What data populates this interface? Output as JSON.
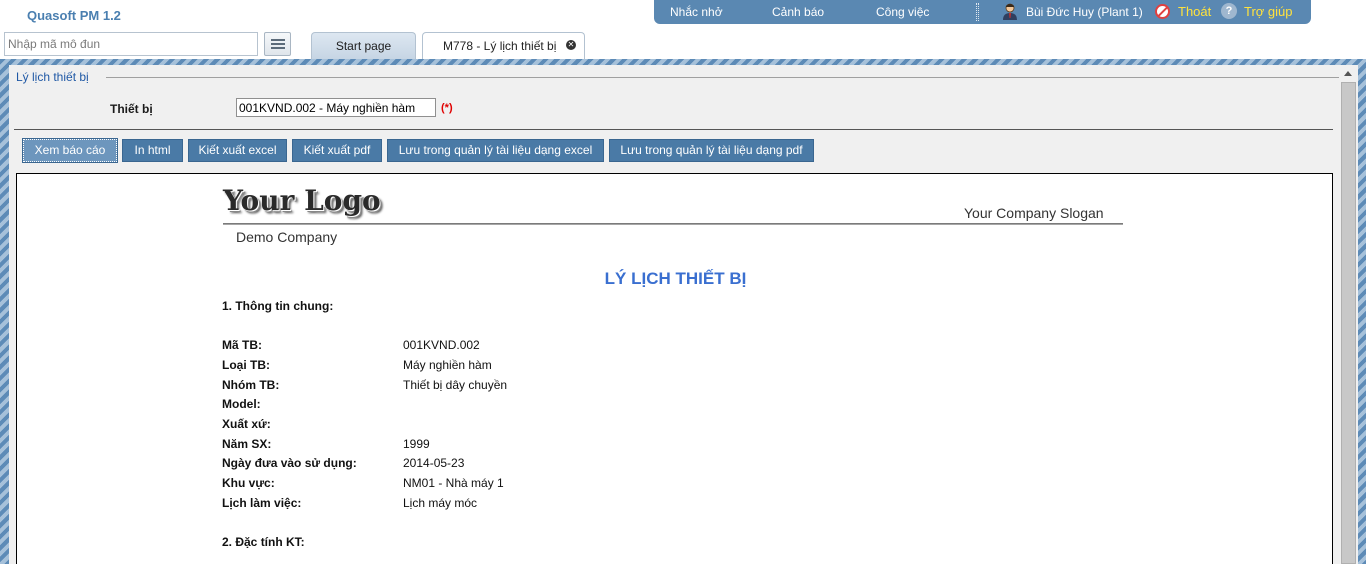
{
  "app": {
    "title": "Quasoft PM 1.2"
  },
  "top_nav": {
    "reminders": "Nhắc nhở",
    "alerts": "Cảnh báo",
    "tasks": "Công việc",
    "user": "Bùi Đức Huy (Plant 1)",
    "logout": "Thoát",
    "help": "Trợ giúp",
    "user_icon": "user-avatar-icon",
    "logout_icon": "no-entry-icon",
    "help_icon": "question-icon"
  },
  "module_search": {
    "placeholder": "Nhập mã mô đun",
    "value": ""
  },
  "tabs": [
    {
      "label": "Start page"
    },
    {
      "label": "M778 - Lý lịch thiết bị"
    }
  ],
  "form": {
    "section_title": "Lý lịch thiết bị",
    "device_label": "Thiết bị",
    "device_value": "001KVND.002 - Máy nghiền hàm",
    "required_mark": "(*)"
  },
  "toolbar": {
    "view_report": "Xem báo cáo",
    "print_html": "In html",
    "export_excel": "Kiết xuất excel",
    "export_pdf": "Kiết xuất pdf",
    "save_doc_excel": "Lưu trong quản lý tài liệu dạng excel",
    "save_doc_pdf": "Lưu trong quản lý tài liệu dạng pdf"
  },
  "report": {
    "logo_text": "Your Logo",
    "slogan": "Your Company Slogan",
    "company": "Demo Company",
    "title": "LÝ LỊCH THIẾT BỊ",
    "section1": "1. Thông tin chung:",
    "section2": "2. Đặc tính KT:",
    "rows": [
      {
        "label": "Mã TB:",
        "value": "001KVND.002"
      },
      {
        "label": "Loại TB:",
        "value": "Máy nghiền hàm"
      },
      {
        "label": "Nhóm TB:",
        "value": "Thiết bị dây chuyền"
      },
      {
        "label": "Model:",
        "value": ""
      },
      {
        "label": "Xuất xứ:",
        "value": ""
      },
      {
        "label": "Năm SX:",
        "value": "1999"
      },
      {
        "label": "Ngày đưa vào sử dụng:",
        "value": "2014-05-23"
      },
      {
        "label": "Khu vực:",
        "value": "NM01 - Nhà máy 1"
      },
      {
        "label": "Lịch làm việc:",
        "value": "Lịch máy móc"
      }
    ]
  },
  "colors": {
    "brand_blue": "#4a7aa6",
    "nav_bar": "#5a88b2",
    "title_blue": "#3a6fd0",
    "required_red": "#e00000",
    "link_yellow": "#ffe23d"
  }
}
